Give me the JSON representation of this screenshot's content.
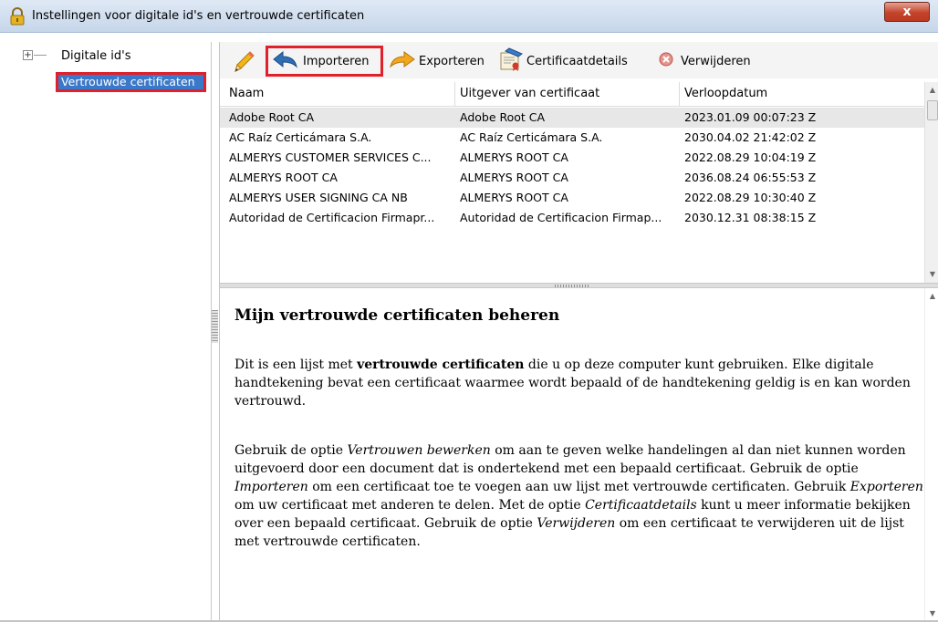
{
  "window": {
    "title": "Instellingen voor digitale id's en vertrouwde certificaten",
    "close_label": "x"
  },
  "tree": {
    "expander": "+",
    "items": [
      {
        "label": "Digitale id's"
      },
      {
        "label": "Vertrouwde certificaten",
        "selected": true
      }
    ]
  },
  "toolbar": {
    "import_label": "Importeren",
    "export_label": "Exporteren",
    "details_label": "Certificaatdetails",
    "remove_label": "Verwijderen"
  },
  "table": {
    "columns": [
      "Naam",
      "Uitgever van certificaat",
      "Verloopdatum"
    ],
    "rows": [
      [
        "Adobe Root CA",
        "Adobe Root CA",
        "2023.01.09 00:07:23 Z"
      ],
      [
        "AC Raíz Certicámara S.A.",
        "AC Raíz Certicámara S.A.",
        "2030.04.02 21:42:02 Z"
      ],
      [
        "ALMERYS CUSTOMER SERVICES C...",
        "ALMERYS ROOT CA",
        "2022.08.29 10:04:19 Z"
      ],
      [
        "ALMERYS ROOT CA",
        "ALMERYS ROOT CA",
        "2036.08.24 06:55:53 Z"
      ],
      [
        "ALMERYS USER SIGNING CA NB",
        "ALMERYS ROOT CA",
        "2022.08.29 10:30:40 Z"
      ],
      [
        "Autoridad de Certificacion Firmapr...",
        "Autoridad de Certificacion Firmap...",
        "2030.12.31 08:38:15 Z"
      ]
    ]
  },
  "description": {
    "title": "Mijn vertrouwde certificaten beheren",
    "p1_a": "Dit is een lijst met ",
    "p1_b": "vertrouwde certificaten",
    "p1_c": " die u op deze computer kunt gebruiken. Elke digitale handtekening bevat een certificaat waarmee wordt bepaald of de handtekening geldig is en kan worden vertrouwd.",
    "p2_a": "Gebruik de optie ",
    "p2_b": "Vertrouwen bewerken",
    "p2_c": " om aan te geven welke handelingen al dan niet kunnen worden uitgevoerd door een document dat is ondertekend met een bepaald certificaat. Gebruik de optie ",
    "p2_d": "Importeren",
    "p2_e": " om een certificaat toe te voegen aan uw lijst met vertrouwde certificaten. Gebruik ",
    "p2_f": "Exporteren",
    "p2_g": " om uw certificaat met anderen te delen. Met de optie ",
    "p2_h": "Certificaatdetails",
    "p2_i": " kunt u meer informatie bekijken over een bepaald certificaat. Gebruik de optie ",
    "p2_j": "Verwijderen",
    "p2_k": " om een certificaat te verwijderen uit de lijst met vertrouwde certificaten."
  },
  "colors": {
    "highlight_box": "#e0202a",
    "selection": "#3a78c9",
    "close_button": "#c4442b"
  }
}
